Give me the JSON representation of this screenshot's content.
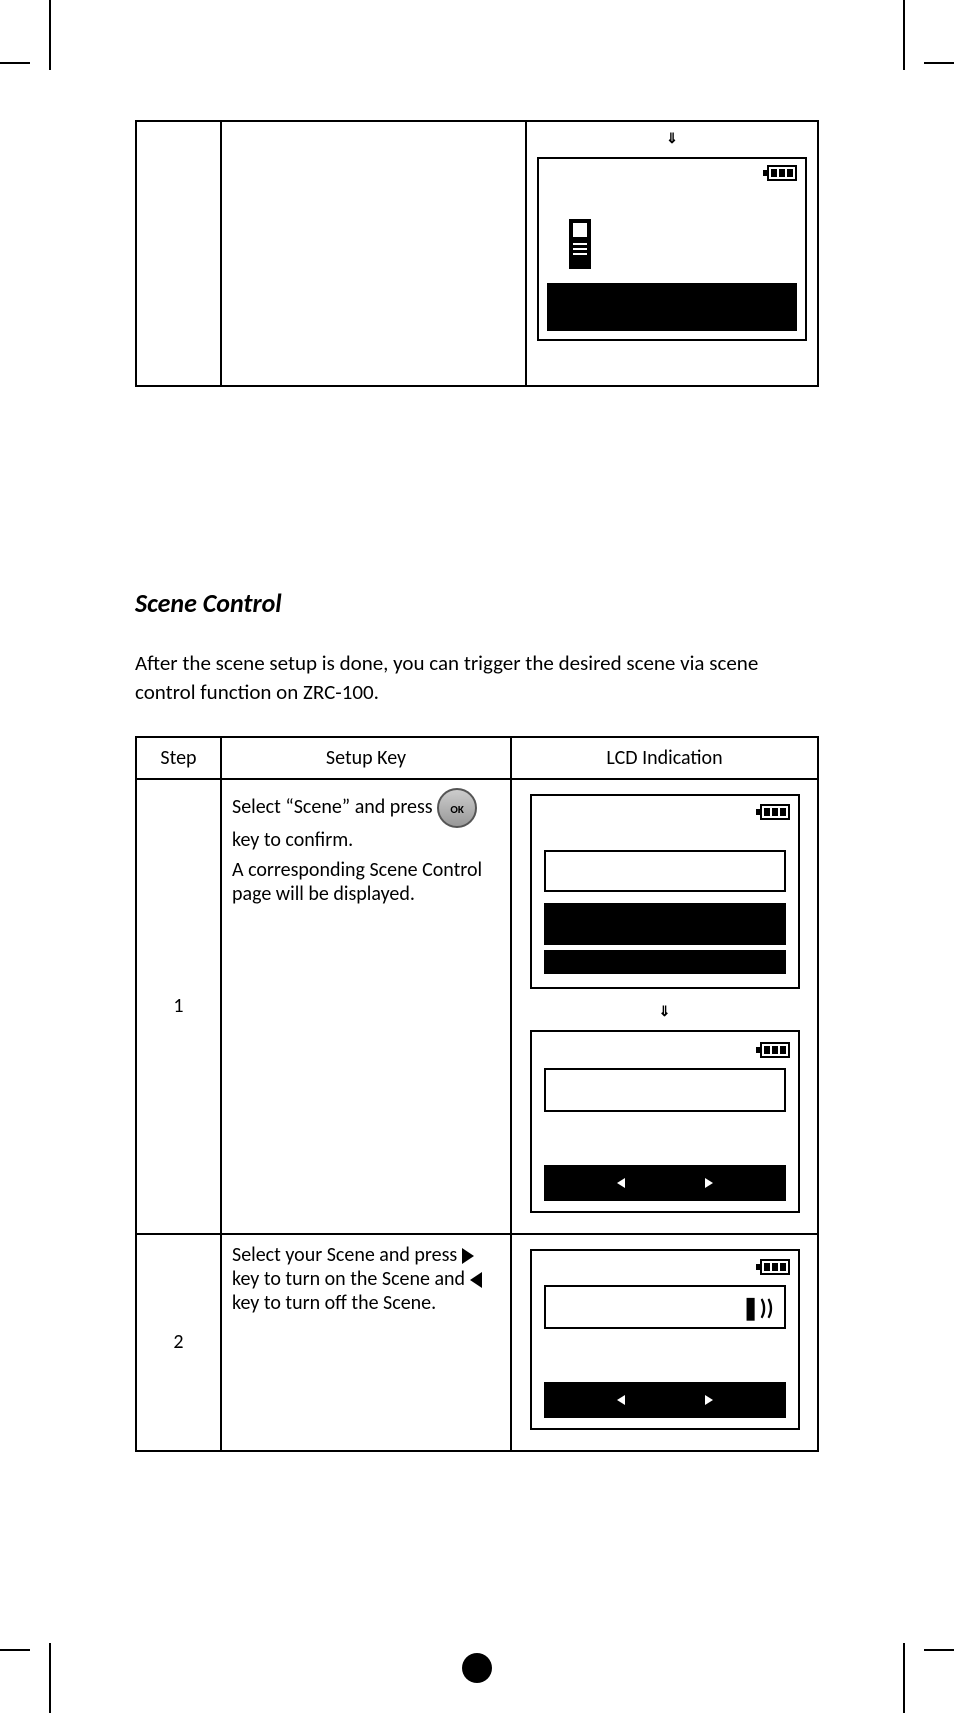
{
  "section": {
    "title": "Scene Control",
    "intro": "After the scene setup is done, you can trigger the desired scene via scene control function on ZRC-100."
  },
  "headers": {
    "step": "Step",
    "setup_key": "Setup Key",
    "lcd": "LCD Indication"
  },
  "rows": [
    {
      "step": "1",
      "text": {
        "line1a": "Select ",
        "scene_word": "“Scene”",
        "line1b": " and press ",
        "ok_label": "OK",
        "line1c": " key to confirm.",
        "line2": "A corresponding Scene Control page will be displayed."
      }
    },
    {
      "step": "2",
      "text": {
        "line1": "Select your Scene and press ",
        "line2": " key to turn on the Scene and ",
        "line3": " key to turn off the Scene."
      }
    }
  ],
  "signal_glyph": "❚))",
  "arrow_glyph": "⇓"
}
